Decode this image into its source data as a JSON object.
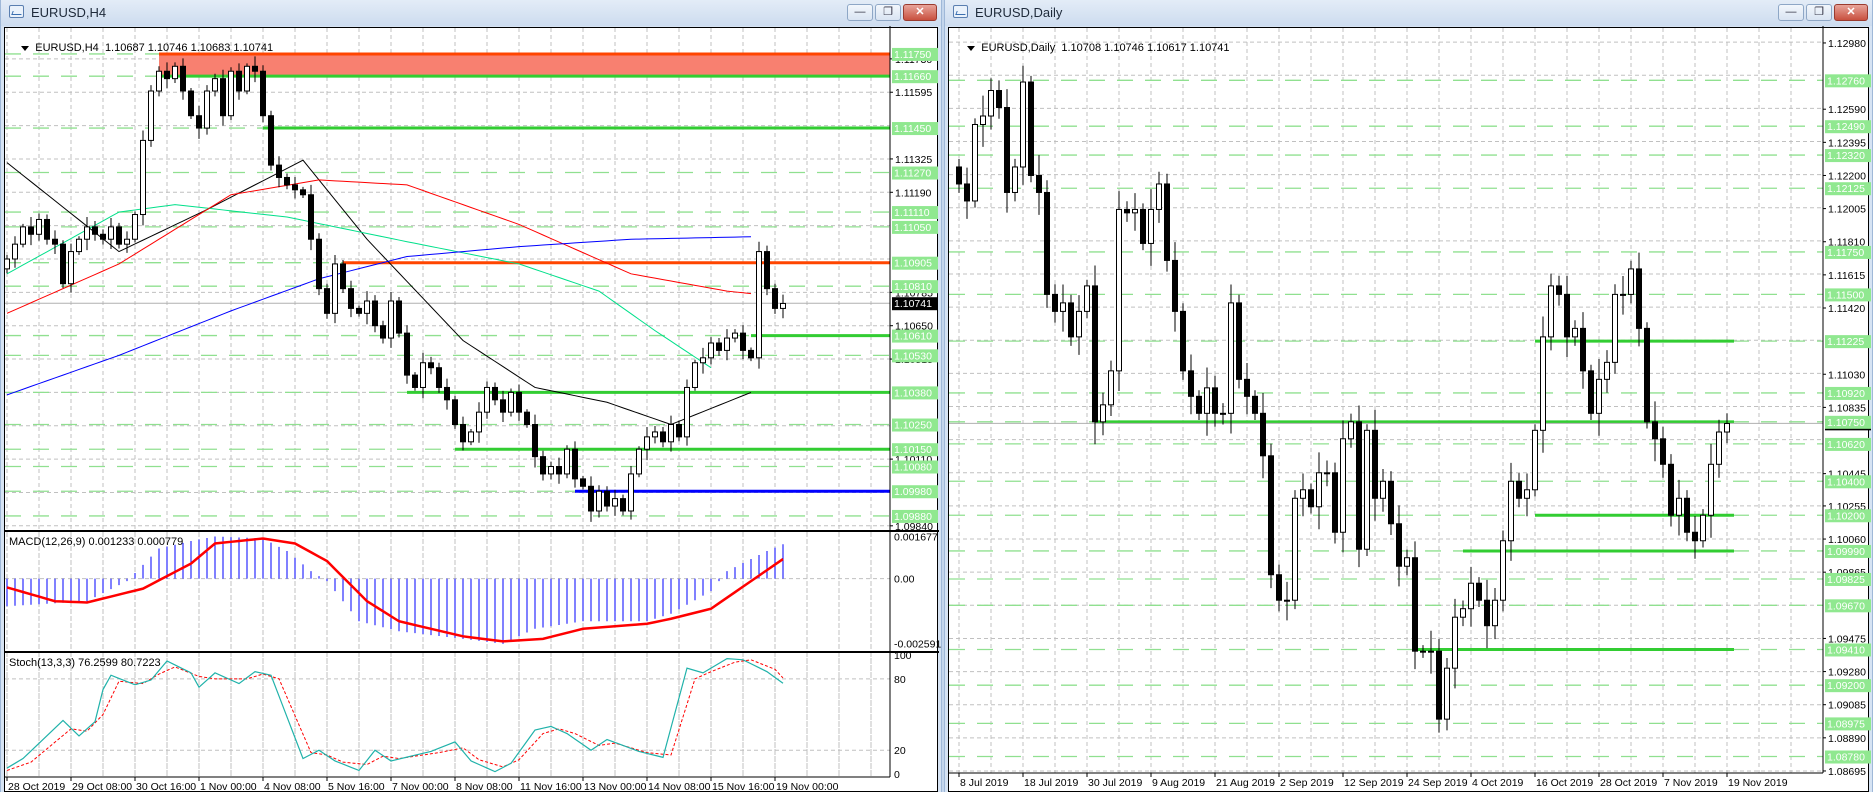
{
  "left": {
    "title": "EURUSD,H4",
    "info_symbol": "EURUSD,H4",
    "info_ohlc": "1.10687 1.10746 1.10683 1.10741",
    "buttons": {
      "minimize": "—",
      "restore": "❐",
      "close": "✕"
    },
    "chart": {
      "type": "candlestick",
      "timeframe": "H4",
      "ylim": [
        1.09819,
        1.11855
      ],
      "grid_base": 1.0984,
      "grid_step": 0.00135,
      "first_open": 1.1088,
      "closes": [
        1.1092,
        1.1098,
        1.1105,
        1.1102,
        1.1108,
        1.11,
        1.1098,
        1.1082,
        1.1095,
        1.11,
        1.1105,
        1.1102,
        1.11,
        1.1105,
        1.1098,
        1.11,
        1.111,
        1.114,
        1.116,
        1.1168,
        1.1165,
        1.117,
        1.116,
        1.115,
        1.1145,
        1.116,
        1.1165,
        1.115,
        1.1168,
        1.116,
        1.117,
        1.1168,
        1.115,
        1.113,
        1.1125,
        1.1122,
        1.112,
        1.1118,
        1.11,
        1.108,
        1.107,
        1.109,
        1.108,
        1.1072,
        1.107,
        1.1075,
        1.1065,
        1.106,
        1.1075,
        1.1062,
        1.1045,
        1.104,
        1.105,
        1.1048,
        1.104,
        1.1035,
        1.1025,
        1.1018,
        1.1022,
        1.103,
        1.104,
        1.1035,
        1.103,
        1.1038,
        1.103,
        1.1025,
        1.1012,
        1.1005,
        1.1008,
        1.1005,
        1.1015,
        1.1003,
        1.1,
        1.099,
        1.0998,
        1.0992,
        1.0995,
        1.099,
        1.1005,
        1.1015,
        1.102,
        1.1022,
        1.1018,
        1.1025,
        1.102,
        1.104,
        1.105,
        1.1052,
        1.1058,
        1.1055,
        1.106,
        1.1062,
        1.1055,
        1.1052,
        1.1095,
        1.108,
        1.1072,
        1.1074
      ],
      "current_price": "1.10741",
      "tick_labels": [
        "1.11730",
        "1.11595",
        "1.11325",
        "1.11190",
        "1.10785",
        "1.10650",
        "1.10515",
        "1.10110",
        "1.09840"
      ],
      "level_labels": [
        "1.11750",
        "1.11660",
        "1.11450",
        "1.11270",
        "1.11110",
        "1.11050",
        "1.10905",
        "1.10810",
        "1.10610",
        "1.10530",
        "1.10380",
        "1.10250",
        "1.10150",
        "1.10080",
        "1.09980",
        "1.09880"
      ],
      "zone": {
        "from_bar": 19,
        "low": 1.1166,
        "high": 1.1175,
        "fill": "#f88070",
        "edge": "#ff4500"
      },
      "lines": [
        {
          "price": 1.1166,
          "from_bar": 19,
          "color": "#32cd32"
        },
        {
          "price": 1.1145,
          "from_bar": 32,
          "color": "#32cd32"
        },
        {
          "price": 1.10905,
          "from_bar": 42,
          "color": "#ff4500"
        },
        {
          "price": 1.1061,
          "from_bar": 93,
          "color": "#32cd32"
        },
        {
          "price": 1.1038,
          "from_bar": 50,
          "color": "#32cd32"
        },
        {
          "price": 1.1015,
          "from_bar": 56,
          "color": "#32cd32"
        },
        {
          "price": 1.0998,
          "from_bar": 71,
          "color": "#0000ff"
        }
      ],
      "moving_averages": [
        {
          "name": "ma-black",
          "color": "#000000",
          "points": [
            [
              0,
              1.1131
            ],
            [
              14,
              1.1095
            ],
            [
              25,
              1.1112
            ],
            [
              37,
              1.1132
            ],
            [
              45,
              1.11
            ],
            [
              57,
              1.1059
            ],
            [
              66,
              1.104
            ],
            [
              75,
              1.1034
            ],
            [
              83,
              1.1025
            ],
            [
              93,
              1.1038
            ]
          ]
        },
        {
          "name": "ma-green",
          "color": "#00e08a",
          "points": [
            [
              0,
              1.1086
            ],
            [
              14,
              1.1111
            ],
            [
              21,
              1.1114
            ],
            [
              35,
              1.1109
            ],
            [
              50,
              1.1099
            ],
            [
              64,
              1.109
            ],
            [
              74,
              1.1079
            ],
            [
              81,
              1.1063
            ],
            [
              88,
              1.1048
            ]
          ]
        },
        {
          "name": "ma-red",
          "color": "#ff0000",
          "points": [
            [
              0,
              1.107
            ],
            [
              14,
              1.109
            ],
            [
              28,
              1.1118
            ],
            [
              39,
              1.1124
            ],
            [
              50,
              1.1122
            ],
            [
              64,
              1.1106
            ],
            [
              78,
              1.1086
            ],
            [
              90,
              1.1079
            ],
            [
              93,
              1.1078
            ]
          ]
        },
        {
          "name": "ma-blue",
          "color": "#0000ff",
          "points": [
            [
              0,
              1.1037
            ],
            [
              14,
              1.1053
            ],
            [
              28,
              1.1071
            ],
            [
              39,
              1.1084
            ],
            [
              50,
              1.1093
            ],
            [
              64,
              1.1097
            ],
            [
              78,
              1.11
            ],
            [
              93,
              1.1101
            ]
          ]
        }
      ],
      "date_labels": [
        "28 Oct 2019",
        "29 Oct 08:00",
        "30 Oct 16:00",
        "1 Nov 00:00",
        "4 Nov 08:00",
        "5 Nov 16:00",
        "7 Nov 00:00",
        "8 Nov 08:00",
        "11 Nov 16:00",
        "13 Nov 00:00",
        "14 Nov 08:00",
        "15 Nov 16:00",
        "19 Nov 00:00"
      ]
    },
    "macd": {
      "label": "MACD(12,26,9) 0.001233 0.000779",
      "ylim": [
        -0.002885,
        0.001818
      ],
      "axis_labels": [
        {
          "value": 0.001677,
          "text": "0.001677"
        },
        {
          "value": 0,
          "text": "0.00"
        },
        {
          "value": -0.002591,
          "text": "-0.002591"
        }
      ],
      "histogram_points": [
        [
          0,
          -0.0011
        ],
        [
          10,
          -0.0009
        ],
        [
          15,
          -0.0001
        ],
        [
          19,
          0.0012
        ],
        [
          23,
          0.0015
        ],
        [
          26,
          0.00168
        ],
        [
          32,
          0.0016
        ],
        [
          35,
          0.0011
        ],
        [
          38,
          0.0003
        ],
        [
          40,
          -0.0001
        ],
        [
          44,
          -0.0017
        ],
        [
          49,
          -0.0021
        ],
        [
          57,
          -0.0024
        ],
        [
          62,
          -0.0026
        ],
        [
          66,
          -0.002
        ],
        [
          72,
          -0.0017
        ],
        [
          80,
          -0.0017
        ],
        [
          83,
          -0.0014
        ],
        [
          88,
          -0.0005
        ],
        [
          90,
          0.0003
        ],
        [
          95,
          0.0011
        ],
        [
          97,
          0.00137
        ]
      ],
      "signal_points": [
        [
          0,
          -0.00035
        ],
        [
          6,
          -0.0009
        ],
        [
          10,
          -0.00095
        ],
        [
          17,
          -0.0004
        ],
        [
          23,
          0.0006
        ],
        [
          26,
          0.0014
        ],
        [
          32,
          0.0016
        ],
        [
          36,
          0.0014
        ],
        [
          40,
          0.0007
        ],
        [
          45,
          -0.0009
        ],
        [
          49,
          -0.0017
        ],
        [
          57,
          -0.0023
        ],
        [
          62,
          -0.0025
        ],
        [
          67,
          -0.0024
        ],
        [
          72,
          -0.002
        ],
        [
          80,
          -0.0018
        ],
        [
          83,
          -0.0016
        ],
        [
          88,
          -0.0012
        ],
        [
          93,
          -0.0001
        ],
        [
          97,
          0.000779
        ]
      ]
    },
    "stoch": {
      "label": "Stoch(13,3,3) 76.2599 80.7223",
      "ylim": [
        -2.5,
        101.7
      ],
      "levels": [
        100,
        80,
        20,
        0
      ],
      "axis_labels": [
        "100",
        "80",
        "20",
        "0"
      ],
      "main_points": [
        [
          0,
          5
        ],
        [
          2,
          13
        ],
        [
          7,
          45
        ],
        [
          9,
          32
        ],
        [
          11,
          44
        ],
        [
          12,
          71
        ],
        [
          13,
          83
        ],
        [
          16,
          75
        ],
        [
          18,
          79
        ],
        [
          20,
          95
        ],
        [
          23,
          85
        ],
        [
          24,
          73
        ],
        [
          26,
          85
        ],
        [
          29,
          76
        ],
        [
          31,
          86
        ],
        [
          33,
          83
        ],
        [
          37,
          13
        ],
        [
          39,
          20
        ],
        [
          41,
          11
        ],
        [
          44,
          3
        ],
        [
          46,
          20
        ],
        [
          48,
          11
        ],
        [
          53,
          19
        ],
        [
          56,
          27
        ],
        [
          58,
          11
        ],
        [
          61,
          2
        ],
        [
          63,
          9
        ],
        [
          66,
          37
        ],
        [
          68,
          40
        ],
        [
          70,
          34
        ],
        [
          73,
          20
        ],
        [
          75,
          29
        ],
        [
          79,
          19
        ],
        [
          82,
          14
        ],
        [
          85,
          89
        ],
        [
          87,
          85
        ],
        [
          90,
          97
        ],
        [
          92,
          96
        ],
        [
          95,
          86
        ],
        [
          97,
          76.26
        ]
      ],
      "signal_points": [
        [
          0,
          3
        ],
        [
          3,
          10
        ],
        [
          8,
          38
        ],
        [
          10,
          36
        ],
        [
          12,
          50
        ],
        [
          14,
          78
        ],
        [
          17,
          76
        ],
        [
          19,
          84
        ],
        [
          21,
          90
        ],
        [
          24,
          82
        ],
        [
          26,
          80
        ],
        [
          28,
          80
        ],
        [
          30,
          80
        ],
        [
          32,
          84
        ],
        [
          34,
          80
        ],
        [
          38,
          18
        ],
        [
          40,
          16
        ],
        [
          42,
          10
        ],
        [
          45,
          8
        ],
        [
          47,
          15
        ],
        [
          49,
          13
        ],
        [
          54,
          18
        ],
        [
          57,
          22
        ],
        [
          59,
          12
        ],
        [
          62,
          6
        ],
        [
          64,
          12
        ],
        [
          67,
          34
        ],
        [
          69,
          38
        ],
        [
          71,
          34
        ],
        [
          74,
          24
        ],
        [
          76,
          26
        ],
        [
          80,
          18
        ],
        [
          83,
          16
        ],
        [
          86,
          80
        ],
        [
          88,
          86
        ],
        [
          91,
          94
        ],
        [
          93,
          96
        ],
        [
          96,
          88
        ],
        [
          97,
          80.72
        ]
      ]
    }
  },
  "right": {
    "title": "EURUSD,Daily",
    "info_symbol": "EURUSD,Daily",
    "info_ohlc": "1.10708 1.10746 1.10617 1.10741",
    "buttons": {
      "minimize": "—",
      "restore": "❐",
      "close": "✕"
    },
    "chart": {
      "type": "candlestick",
      "timeframe": "Daily",
      "ylim": [
        1.08683,
        1.13068
      ],
      "grid_base": 1.08695,
      "grid_step": 0.00195,
      "first_open": 1.1225,
      "closes": [
        1.1215,
        1.1205,
        1.125,
        1.1255,
        1.127,
        1.126,
        1.121,
        1.1225,
        1.1275,
        1.122,
        1.121,
        1.115,
        1.114,
        1.1145,
        1.1125,
        1.114,
        1.1155,
        1.1075,
        1.1085,
        1.1105,
        1.12,
        1.1198,
        1.12,
        1.118,
        1.12,
        1.1215,
        1.117,
        1.114,
        1.1105,
        1.109,
        1.108,
        1.1095,
        1.108,
        1.108,
        1.1145,
        1.11,
        1.109,
        1.108,
        1.1055,
        1.0985,
        1.097,
        1.097,
        1.103,
        1.1035,
        1.1025,
        1.1045,
        1.1045,
        1.101,
        1.1065,
        1.1075,
        1.1,
        1.107,
        1.103,
        1.104,
        1.1015,
        1.099,
        1.0995,
        1.094,
        1.094,
        1.094,
        1.09,
        1.093,
        1.096,
        1.0965,
        1.098,
        1.097,
        1.0955,
        1.097,
        1.1005,
        1.104,
        1.103,
        1.1035,
        1.107,
        1.1125,
        1.1155,
        1.115,
        1.1125,
        1.113,
        1.1105,
        1.108,
        1.11,
        1.111,
        1.115,
        1.115,
        1.1165,
        1.113,
        1.1075,
        1.1065,
        1.105,
        1.102,
        1.103,
        1.101,
        1.1005,
        1.102,
        1.105,
        1.1069,
        1.1074
      ],
      "current_price": "1.10741",
      "tick_labels": [
        "1.12980",
        "1.12590",
        "1.12395",
        "1.12200",
        "1.12005",
        "1.11810",
        "1.11615",
        "1.11420",
        "1.11030",
        "1.10835",
        "1.10445",
        "1.10255",
        "1.10060",
        "1.09865",
        "1.09475",
        "1.09280",
        "1.09085",
        "1.08890",
        "1.08695"
      ],
      "level_labels": [
        "1.12760",
        "1.12490",
        "1.12320",
        "1.12125",
        "1.11750",
        "1.11500",
        "1.11225",
        "1.10920",
        "1.10750",
        "1.10620",
        "1.10400",
        "1.10200",
        "1.09990",
        "1.09825",
        "1.09670",
        "1.09410",
        "1.09200",
        "1.08975",
        "1.08780"
      ],
      "lines": [
        {
          "price": 1.11225,
          "from_bar": 72,
          "color": "#32cd32"
        },
        {
          "price": 1.1075,
          "from_bar": 17,
          "color": "#32cd32"
        },
        {
          "price": 1.102,
          "from_bar": 72,
          "color": "#32cd32"
        },
        {
          "price": 1.0999,
          "from_bar": 63,
          "color": "#32cd32"
        },
        {
          "price": 1.0941,
          "from_bar": 57,
          "color": "#32cd32"
        }
      ],
      "date_labels": [
        "8 Jul 2019",
        "18 Jul 2019",
        "30 Jul 2019",
        "9 Aug 2019",
        "21 Aug 2019",
        "2 Sep 2019",
        "12 Sep 2019",
        "24 Sep 2019",
        "4 Oct 2019",
        "16 Oct 2019",
        "28 Oct 2019",
        "7 Nov 2019",
        "19 Nov 2019"
      ]
    }
  }
}
